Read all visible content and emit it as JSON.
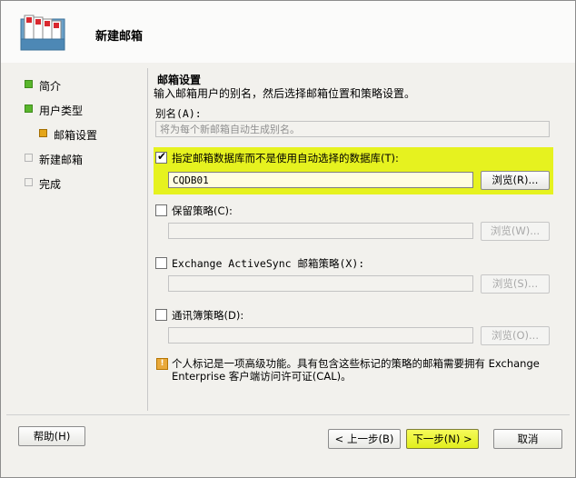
{
  "header": {
    "title": "新建邮箱",
    "icon": "mailbox-wizard-icon"
  },
  "nav": {
    "items": [
      {
        "label": "简介",
        "state": "done"
      },
      {
        "label": "用户类型",
        "state": "done"
      },
      {
        "label": "邮箱设置",
        "state": "current"
      },
      {
        "label": "新建邮箱",
        "state": "pending"
      },
      {
        "label": "完成",
        "state": "pending"
      }
    ]
  },
  "main": {
    "section_title": "邮箱设置",
    "description": "输入邮箱用户的别名，然后选择邮箱位置和策略设置。",
    "alias": {
      "label": "别名(A):",
      "placeholder": "将为每个新邮箱自动生成别名。"
    },
    "database": {
      "checkbox_label": "指定邮箱数据库而不是使用自动选择的数据库(T):",
      "checked": true,
      "value": "CQDB01",
      "browse_label": "浏览(R)..."
    },
    "retention": {
      "checkbox_label": "保留策略(C):",
      "checked": false,
      "value": "",
      "browse_label": "浏览(W)..."
    },
    "activesync": {
      "checkbox_label": "Exchange ActiveSync 邮箱策略(X):",
      "checked": false,
      "value": "",
      "browse_label": "浏览(S)..."
    },
    "addressbook": {
      "checkbox_label": "通讯簿策略(D):",
      "checked": false,
      "value": "",
      "browse_label": "浏览(O)..."
    },
    "info_line1": "个人标记是一项高级功能。具有包含这些标记的策略的邮箱需要拥有 Exchange",
    "info_line2": "Enterprise 客户端访问许可证(CAL)。"
  },
  "footer": {
    "help_label": "帮助(H)",
    "back_label": "< 上一步(B)",
    "next_label": "下一步(N) >",
    "cancel_label": "取消"
  },
  "colors": {
    "highlight": "#e6f21f",
    "done": "#59b62c",
    "current": "#e5a619"
  }
}
